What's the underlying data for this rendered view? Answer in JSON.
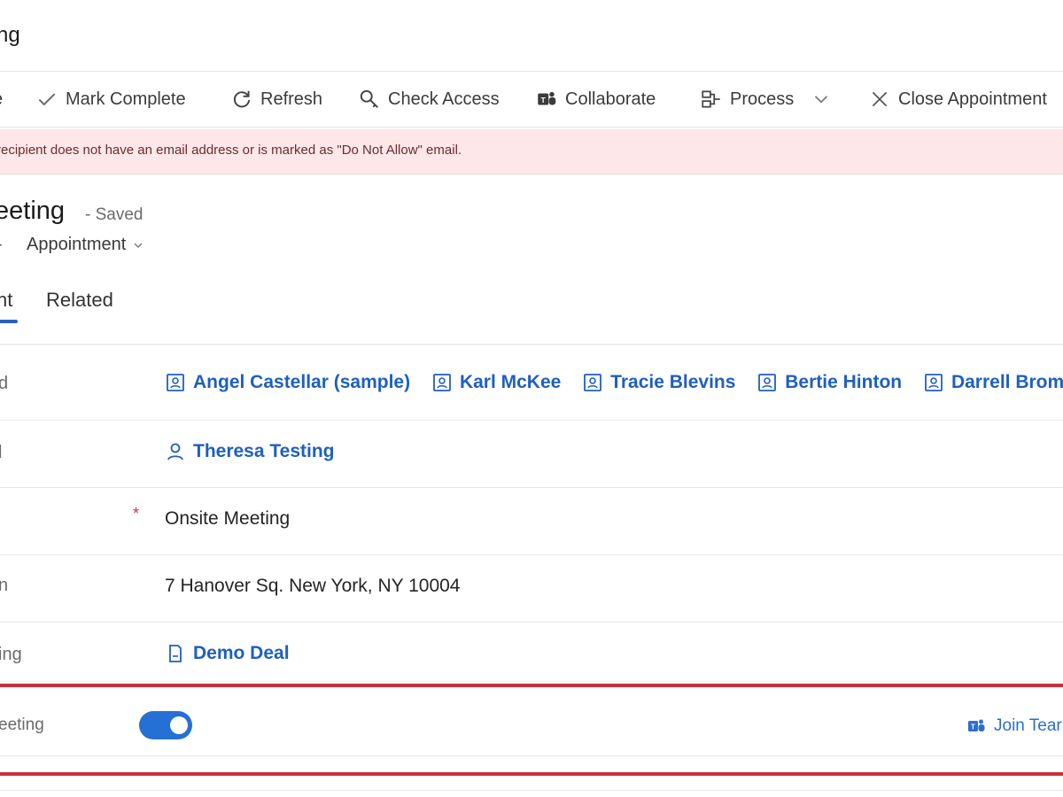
{
  "window": {
    "title": "ng"
  },
  "toolbar": {
    "items": [
      {
        "label": "Mark Complete",
        "icon": "checkmark-icon"
      },
      {
        "label": "Refresh",
        "icon": "refresh-icon"
      },
      {
        "label": "Check Access",
        "icon": "check-access-icon"
      },
      {
        "label": "Collaborate",
        "icon": "teams-icon"
      },
      {
        "label": "Process",
        "icon": "process-icon"
      },
      {
        "label": "Close Appointment",
        "icon": "close-icon"
      }
    ]
  },
  "banner": {
    "text": "recipient does not have an email address or is marked as \"Do Not Allow\" email."
  },
  "record": {
    "title": "eeting",
    "status": "- Saved",
    "type_prefix": "-",
    "type": "Appointment"
  },
  "tabs": [
    {
      "label": "nt",
      "active": true
    },
    {
      "label": "Related",
      "active": false
    }
  ],
  "form": {
    "rows": [
      {
        "label": "d",
        "lookups": [
          {
            "text": "Angel Castellar (sample)",
            "icon": "contact-card-icon"
          },
          {
            "text": "Karl McKee",
            "icon": "contact-card-icon"
          },
          {
            "text": "Tracie Blevins",
            "icon": "contact-card-icon"
          },
          {
            "text": "Bertie Hinton",
            "icon": "contact-card-icon"
          },
          {
            "text": "Darrell Bromley",
            "icon": "contact-card-icon"
          }
        ]
      },
      {
        "label": "l",
        "lookups": [
          {
            "text": "Theresa Testing",
            "icon": "person-icon"
          }
        ]
      },
      {
        "label": "",
        "required_mark": "*",
        "value": "Onsite Meeting"
      },
      {
        "label": "n",
        "value": "7 Hanover Sq. New York, NY 10004"
      },
      {
        "label": "ing",
        "lookups": [
          {
            "text": "Demo Deal",
            "icon": "document-icon"
          }
        ]
      }
    ],
    "teams_row": {
      "label": "eeting",
      "toggle_on": true,
      "join_label": "Join Tear"
    }
  },
  "colors": {
    "accent": "#2570d4",
    "link": "#1f5fbf",
    "banner_bg": "#fde7e9",
    "highlight": "#c8303b"
  }
}
